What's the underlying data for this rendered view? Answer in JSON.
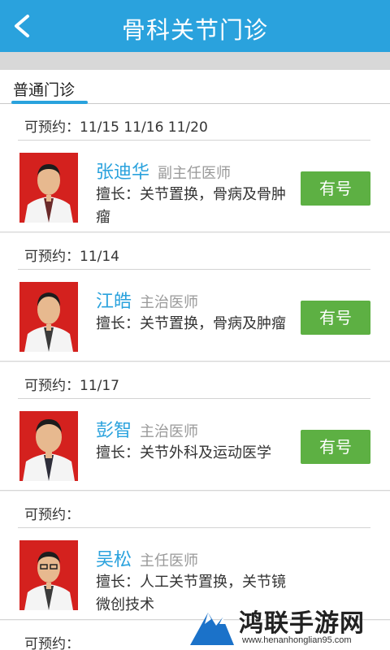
{
  "header": {
    "title": "骨科关节门诊",
    "back_icon": "chevron-left-icon",
    "color": "#2aa2dd"
  },
  "tabs": [
    {
      "label": "普通门诊",
      "active": true
    }
  ],
  "doctors": [
    {
      "available": "可预约：11/15 11/16 11/20",
      "name": "张迪华",
      "rank": "副主任医师",
      "specialty": "擅长：关节置换，骨病及骨肿瘤",
      "button": "有号"
    },
    {
      "available": "可预约：11/14",
      "name": "江皓",
      "rank": "主治医师",
      "specialty": "擅长：关节置换，骨病及肿瘤",
      "button": "有号"
    },
    {
      "available": "可预约：11/17",
      "name": "彭智",
      "rank": "主治医师",
      "specialty": "擅长：关节外科及运动医学",
      "button": "有号"
    },
    {
      "available": "可预约：",
      "name": "吴松",
      "rank": "主任医师",
      "specialty": "擅长：人工关节置换，关节镜微创技术",
      "button": ""
    }
  ],
  "last_available": "可预约：",
  "colors": {
    "accent": "#2aa2dd",
    "button": "#5db043",
    "photo_bg": "#d4211e"
  },
  "watermark": {
    "text": "鸿联手游网",
    "url": "www.henanhonglian95.com"
  }
}
